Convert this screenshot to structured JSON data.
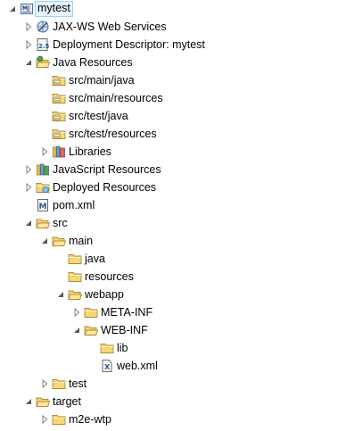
{
  "tree": {
    "rows": [
      {
        "label": "mytest",
        "depth": 0,
        "toggle": "expanded",
        "icon": "maven-project-icon",
        "selected": true
      },
      {
        "label": "JAX-WS Web Services",
        "depth": 1,
        "toggle": "collapsed",
        "icon": "webservices-icon"
      },
      {
        "label": "Deployment Descriptor: mytest",
        "depth": 1,
        "toggle": "collapsed",
        "icon": "deployment-descriptor-icon"
      },
      {
        "label": "Java Resources",
        "depth": 1,
        "toggle": "expanded",
        "icon": "java-resources-icon"
      },
      {
        "label": "src/main/java",
        "depth": 2,
        "toggle": "none",
        "icon": "source-folder-icon"
      },
      {
        "label": "src/main/resources",
        "depth": 2,
        "toggle": "none",
        "icon": "source-folder-icon"
      },
      {
        "label": "src/test/java",
        "depth": 2,
        "toggle": "none",
        "icon": "source-folder-icon"
      },
      {
        "label": "src/test/resources",
        "depth": 2,
        "toggle": "none",
        "icon": "source-folder-icon"
      },
      {
        "label": "Libraries",
        "depth": 2,
        "toggle": "collapsed",
        "icon": "libraries-icon"
      },
      {
        "label": "JavaScript Resources",
        "depth": 1,
        "toggle": "collapsed",
        "icon": "javascript-resources-icon"
      },
      {
        "label": "Deployed Resources",
        "depth": 1,
        "toggle": "collapsed",
        "icon": "deployed-resources-icon"
      },
      {
        "label": "pom.xml",
        "depth": 1,
        "toggle": "none",
        "icon": "maven-pom-icon"
      },
      {
        "label": "src",
        "depth": 1,
        "toggle": "expanded",
        "icon": "open-folder-icon"
      },
      {
        "label": "main",
        "depth": 2,
        "toggle": "expanded",
        "icon": "open-folder-icon"
      },
      {
        "label": "java",
        "depth": 3,
        "toggle": "none",
        "icon": "folder-icon"
      },
      {
        "label": "resources",
        "depth": 3,
        "toggle": "none",
        "icon": "folder-icon"
      },
      {
        "label": "webapp",
        "depth": 3,
        "toggle": "expanded",
        "icon": "open-folder-icon"
      },
      {
        "label": "META-INF",
        "depth": 4,
        "toggle": "collapsed",
        "icon": "folder-icon"
      },
      {
        "label": "WEB-INF",
        "depth": 4,
        "toggle": "expanded",
        "icon": "open-folder-icon"
      },
      {
        "label": "lib",
        "depth": 5,
        "toggle": "none",
        "icon": "folder-icon"
      },
      {
        "label": "web.xml",
        "depth": 5,
        "toggle": "none",
        "icon": "xml-file-icon"
      },
      {
        "label": "test",
        "depth": 2,
        "toggle": "collapsed",
        "icon": "folder-icon"
      },
      {
        "label": "target",
        "depth": 1,
        "toggle": "expanded",
        "icon": "open-folder-icon"
      },
      {
        "label": "m2e-wtp",
        "depth": 2,
        "toggle": "collapsed",
        "icon": "folder-icon"
      }
    ]
  },
  "colors": {
    "selection_bg": "#e5f3ff",
    "selection_border": "#99d1ff",
    "folder_fill": "#f5d776",
    "folder_stroke": "#b08a2e",
    "arrow": "#8c8c8c"
  }
}
